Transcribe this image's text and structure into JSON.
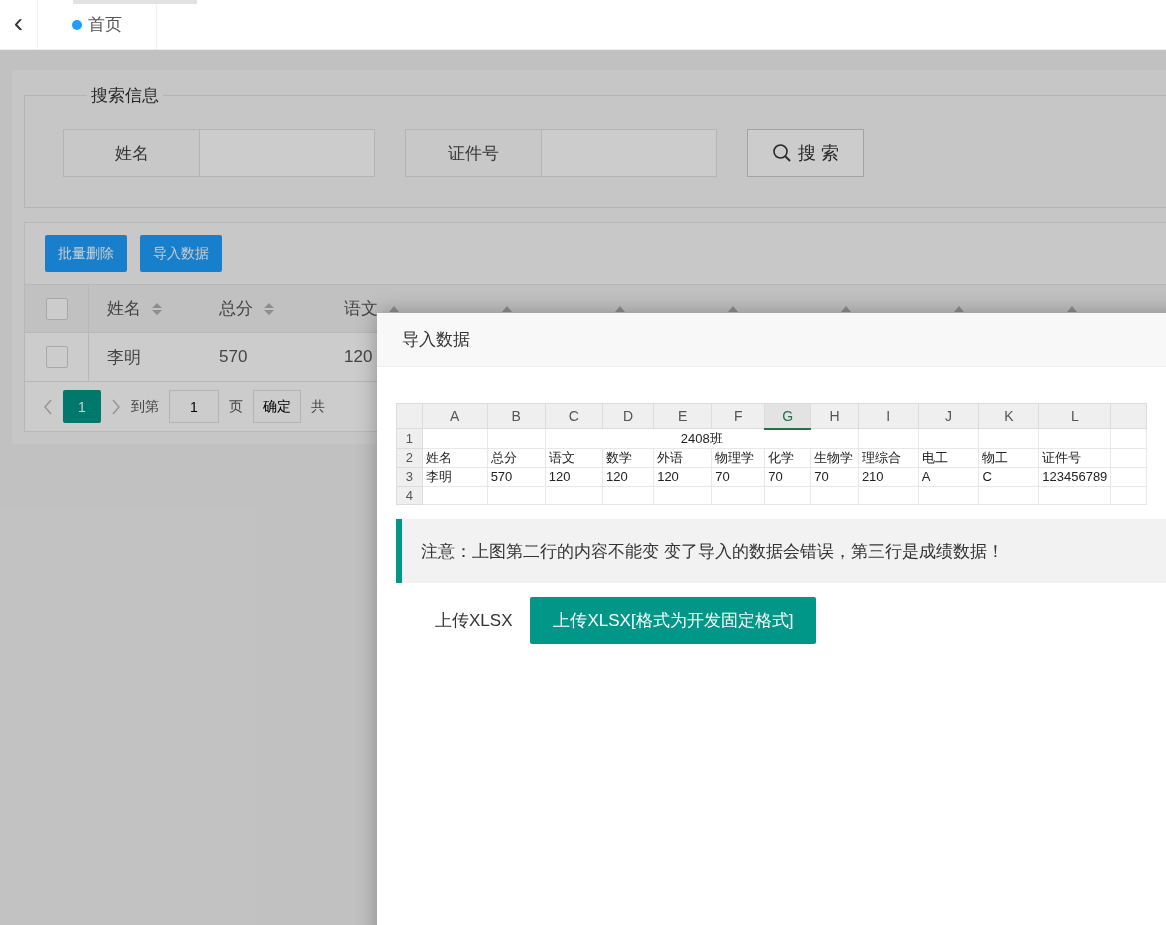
{
  "header": {
    "back": "‹",
    "tabs": [
      {
        "label": "首页",
        "selected": true
      }
    ]
  },
  "search": {
    "legend": "搜索信息",
    "fields": [
      {
        "label": "姓名"
      },
      {
        "label": "证件号"
      }
    ],
    "button": "搜 索"
  },
  "toolbar": {
    "buttons": [
      "批量删除",
      "导入数据"
    ]
  },
  "table": {
    "columns": [
      {
        "label": "姓名",
        "kind": "both"
      },
      {
        "label": "总分",
        "kind": "both"
      },
      {
        "label": "语文",
        "kind": "up"
      },
      {
        "kind": "up"
      },
      {
        "kind": "up"
      },
      {
        "kind": "up"
      },
      {
        "kind": "up"
      },
      {
        "kind": "up"
      },
      {
        "kind": "up"
      }
    ],
    "all_checked": false,
    "rows": [
      {
        "checked": false,
        "cells": [
          "李明",
          "570",
          "120"
        ]
      }
    ]
  },
  "pagination": {
    "pages": [
      {
        "label": "1",
        "selected": true
      }
    ],
    "goto": "到第",
    "page_value": "1",
    "page_unit": "页",
    "confirm": "确定",
    "total": "共"
  },
  "dialog": {
    "title": "导入数据",
    "sheet": {
      "columns": [
        {
          "label": "A",
          "selected": false
        },
        {
          "label": "B",
          "selected": false
        },
        {
          "label": "C",
          "selected": false
        },
        {
          "label": "D",
          "selected": false
        },
        {
          "label": "E",
          "selected": false
        },
        {
          "label": "F",
          "selected": false
        },
        {
          "label": "G",
          "selected": true
        },
        {
          "label": "H",
          "selected": false
        },
        {
          "label": "I",
          "selected": false
        },
        {
          "label": "J",
          "selected": false
        },
        {
          "label": "K",
          "selected": false
        },
        {
          "label": "L",
          "selected": false
        }
      ],
      "title_row": {
        "num": "1",
        "title": "2408班"
      },
      "rows": [
        {
          "num": "2",
          "cells": [
            "姓名",
            "总分",
            "语文",
            "数学",
            "外语",
            "物理学",
            "化学",
            "生物学",
            "理综合",
            "电工",
            "物工",
            "证件号"
          ]
        },
        {
          "num": "3",
          "cells": [
            "李明",
            "570",
            "120",
            "120",
            "120",
            "70",
            "70",
            "70",
            "210",
            "A",
            "C",
            "123456789"
          ]
        },
        {
          "num": "4",
          "cells": []
        }
      ]
    },
    "notice": "注意：上图第二行的内容不能变 变了导入的数据会错误，第三行是成绩数据！",
    "upload_label": "上传XLSX",
    "upload_button": "上传XLSX[格式为开发固定格式]"
  }
}
